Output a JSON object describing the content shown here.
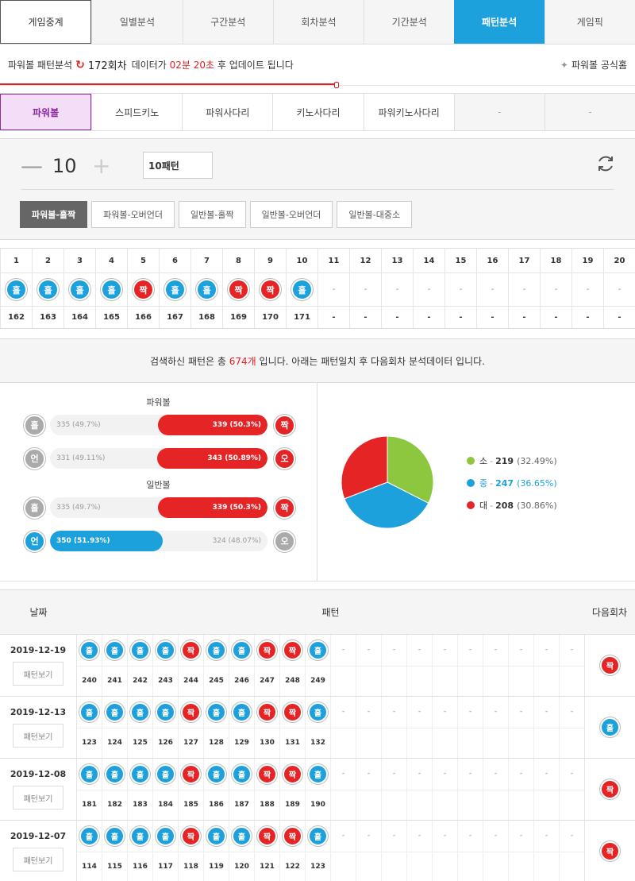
{
  "main_tabs": [
    "게임중계",
    "일별분석",
    "구간분석",
    "회차분석",
    "기간분석",
    "패턴분석",
    "게임픽"
  ],
  "info": {
    "prefix": "파워볼 패턴분석",
    "round": "172회차",
    "mid": "데이터가",
    "time": "02분 20초",
    "suffix": "후 업데이트 됩니다",
    "official": "파워볼 공식홈"
  },
  "sub_tabs": [
    "파워볼",
    "스피드키노",
    "파워사다리",
    "키노사다리",
    "파워키노사다리",
    "-",
    "-"
  ],
  "control": {
    "count": "10",
    "pattern_input": "10패턴",
    "options": [
      "파워볼-홀짝",
      "파워볼-오버언더",
      "일반볼-홀짝",
      "일반볼-오버언더",
      "일반볼-대중소"
    ]
  },
  "grid": {
    "headers": [
      "1",
      "2",
      "3",
      "4",
      "5",
      "6",
      "7",
      "8",
      "9",
      "10",
      "11",
      "12",
      "13",
      "14",
      "15",
      "16",
      "17",
      "18",
      "19",
      "20"
    ],
    "balls": [
      "홀",
      "홀",
      "홀",
      "홀",
      "짝",
      "홀",
      "홀",
      "짝",
      "짝",
      "홀",
      "-",
      "-",
      "-",
      "-",
      "-",
      "-",
      "-",
      "-",
      "-",
      "-"
    ],
    "rounds": [
      "162",
      "163",
      "164",
      "165",
      "166",
      "167",
      "168",
      "169",
      "170",
      "171",
      "-",
      "-",
      "-",
      "-",
      "-",
      "-",
      "-",
      "-",
      "-",
      "-"
    ]
  },
  "summary": {
    "prefix": "검색하신 패턴은 총",
    "count": "674개",
    "suffix": "입니다. 아래는 패턴일치 후 다음회차 분석데이터 입니다."
  },
  "powerball": {
    "title": "파워볼",
    "rows": [
      {
        "left_icon": "홀",
        "left": "335 (49.7%)",
        "right": "339 (50.3%)",
        "right_icon": "짝",
        "win": "right",
        "pct": 50.3
      },
      {
        "left_icon": "언",
        "left": "331 (49.11%)",
        "right": "343 (50.89%)",
        "right_icon": "오",
        "win": "right",
        "pct": 50.89
      }
    ]
  },
  "normalball": {
    "title": "일반볼",
    "rows": [
      {
        "left_icon": "홀",
        "left": "335 (49.7%)",
        "right": "339 (50.3%)",
        "right_icon": "짝",
        "win": "right",
        "pct": 50.3
      },
      {
        "left_icon": "언",
        "left": "350 (51.93%)",
        "right": "324 (48.07%)",
        "right_icon": "오",
        "win": "left",
        "pct": 51.93
      }
    ]
  },
  "pie": {
    "legend": [
      {
        "label": "소",
        "value": "219",
        "pct": "(32.49%)",
        "color": "#8dc63f",
        "num": 219
      },
      {
        "label": "중",
        "value": "247",
        "pct": "(36.65%)",
        "color": "#1da1dc",
        "num": 247
      },
      {
        "label": "대",
        "value": "208",
        "pct": "(30.86%)",
        "color": "#e52525",
        "num": 208
      }
    ]
  },
  "history": {
    "headers": {
      "date": "날짜",
      "pattern": "패턴",
      "next": "다음회차"
    },
    "view_label": "패턴보기",
    "rows": [
      {
        "date": "2019-12-19",
        "balls": [
          "홀",
          "홀",
          "홀",
          "홀",
          "짝",
          "홀",
          "홀",
          "짝",
          "짝",
          "홀"
        ],
        "rounds": [
          "240",
          "241",
          "242",
          "243",
          "244",
          "245",
          "246",
          "247",
          "248",
          "249"
        ],
        "next": "짝"
      },
      {
        "date": "2019-12-13",
        "balls": [
          "홀",
          "홀",
          "홀",
          "홀",
          "짝",
          "홀",
          "홀",
          "짝",
          "짝",
          "홀"
        ],
        "rounds": [
          "123",
          "124",
          "125",
          "126",
          "127",
          "128",
          "129",
          "130",
          "131",
          "132"
        ],
        "next": "홀"
      },
      {
        "date": "2019-12-08",
        "balls": [
          "홀",
          "홀",
          "홀",
          "홀",
          "짝",
          "홀",
          "홀",
          "짝",
          "짝",
          "홀"
        ],
        "rounds": [
          "181",
          "182",
          "183",
          "184",
          "185",
          "186",
          "187",
          "188",
          "189",
          "190"
        ],
        "next": "짝"
      },
      {
        "date": "2019-12-07",
        "balls": [
          "홀",
          "홀",
          "홀",
          "홀",
          "짝",
          "홀",
          "홀",
          "짝",
          "짝",
          "홀"
        ],
        "rounds": [
          "114",
          "115",
          "116",
          "117",
          "118",
          "119",
          "120",
          "121",
          "122",
          "123"
        ],
        "next": "짝"
      }
    ]
  }
}
